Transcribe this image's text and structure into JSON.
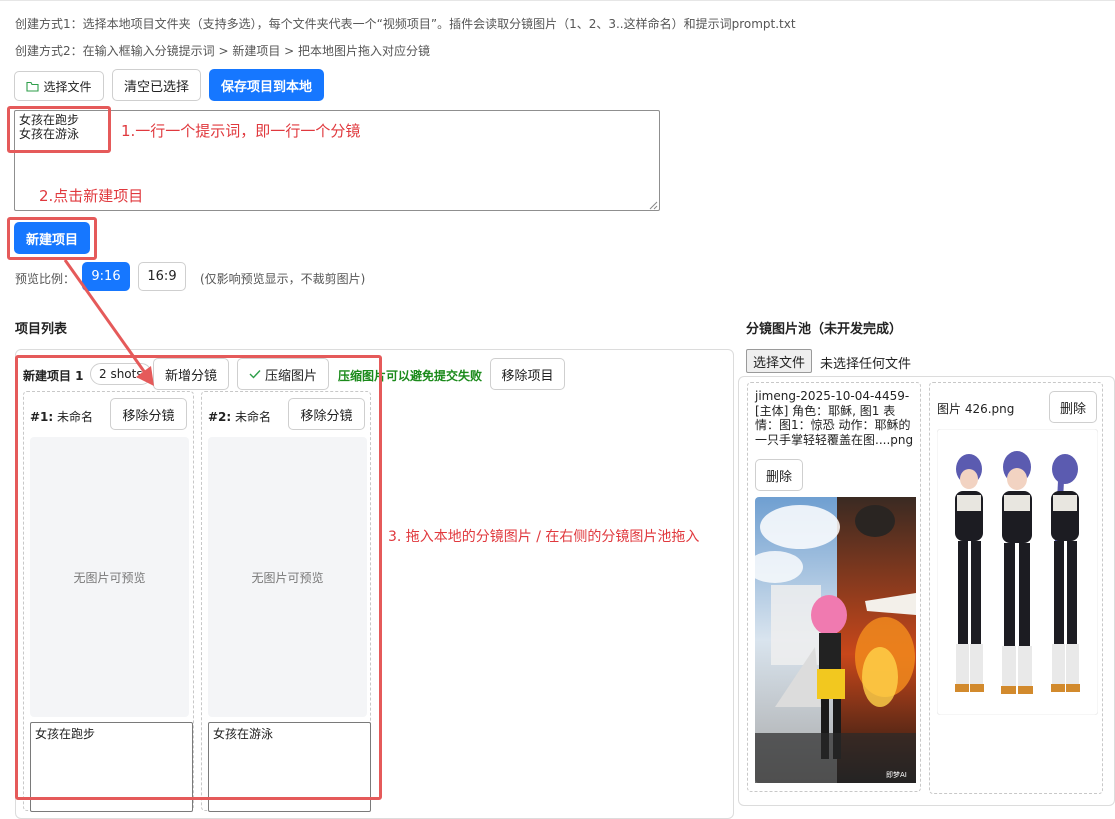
{
  "hints": {
    "line1": "创建方式1：选择本地项目文件夹（支持多选），每个文件夹代表一个“视频项目”。插件会读取分镜图片（1、2、3..这样命名）和提示词prompt.txt",
    "line2": "创建方式2：在输入框输入分镜提示词 > 新建项目 > 把本地图片拖入对应分镜"
  },
  "toolbar": {
    "select_files": "选择文件",
    "clear_selected": "清空已选择",
    "save_local": "保存项目到本地"
  },
  "prompt_input": {
    "value": "女孩在跑步\n女孩在游泳"
  },
  "new_project_button": "新建项目",
  "preview_ratio": {
    "label": "预览比例：",
    "options": [
      "9:16",
      "16:9"
    ],
    "selected": "9:16",
    "note": "(仅影响预览显示，不裁剪图片)"
  },
  "annotations": {
    "a1": "1.一行一个提示词，即一行一个分镜",
    "a2": "2.点击新建项目",
    "a3": "3. 拖入本地的分镜图片 / 在右侧的分镜图片池拖入"
  },
  "project_list": {
    "title": "项目列表",
    "project": {
      "name": "新建项目 1",
      "shots_badge": "2 shots",
      "add_shot": "新增分镜",
      "compress": "压缩图片",
      "compress_hint": "压缩图片可以避免提交失败",
      "remove_project": "移除项目",
      "shots": [
        {
          "index": "#1:",
          "name": "未命名",
          "remove": "移除分镜",
          "no_image": "无图片可预览",
          "prompt": "女孩在跑步"
        },
        {
          "index": "#2:",
          "name": "未命名",
          "remove": "移除分镜",
          "no_image": "无图片可预览",
          "prompt": "女孩在游泳"
        }
      ]
    }
  },
  "pool": {
    "title": "分镜图片池（未开发完成）",
    "file_button": "选择文件",
    "file_status": "未选择任何文件",
    "items": [
      {
        "filename": "jimeng-2025-10-04-4459-[主体] 角色：耶稣, 图1 表情：图1：惊恐 动作：耶稣的一只手掌轻轻覆盖在图....png",
        "delete": "删除",
        "watermark": "即梦AI"
      },
      {
        "filename": "图片 426.png",
        "delete": "删除"
      }
    ]
  },
  "colors": {
    "accent": "#1677ff",
    "annotation": "#e0393e",
    "success": "#1a8a1a"
  }
}
